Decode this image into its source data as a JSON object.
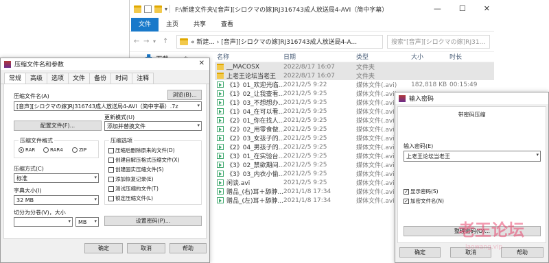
{
  "explorer": {
    "title": "F:\\新建文件夹\\[音声][シロクマの嫁]RJ316743成人放送局4-AVI（简中字幕）",
    "window_buttons": [
      "—",
      "☐",
      "✕"
    ],
    "ribbon_tabs": [
      "文件",
      "主页",
      "共享",
      "查看"
    ],
    "address": "« 新建... › [音声][シロクマの嫁]RJ316743成人放送局4-A...",
    "search_placeholder": "搜索\"[音声][シロクマの嫁]RJ31...",
    "nav_item": "下载",
    "columns": {
      "name": "名称",
      "date": "日期",
      "type": "类型",
      "size": "大小",
      "length": "时长"
    },
    "files": [
      {
        "name": "__MACOSX",
        "date": "2022/8/17 16:07",
        "type": "文件夹",
        "size": "",
        "length": "",
        "icon": "folder",
        "selected": true
      },
      {
        "name": "上老王论坛当老王",
        "date": "2022/8/17 16:07",
        "type": "文件夹",
        "size": "",
        "length": "",
        "icon": "folder",
        "selected": true
      },
      {
        "name": "《1》01_欢迎光临...",
        "date": "2021/2/5 9:22",
        "type": "媒体文件(.avi)",
        "size": "182,818 KB",
        "length": "00:15:49",
        "icon": "media"
      },
      {
        "name": "《1》02_让我查看...",
        "date": "2021/2/5 9:25",
        "type": "媒体文件(.avi)",
        "size": "",
        "length": "",
        "icon": "media"
      },
      {
        "name": "《1》03_不想想办...",
        "date": "2021/2/5 9:25",
        "type": "媒体文件(.avi)",
        "size": "",
        "length": "",
        "icon": "media"
      },
      {
        "name": "《1》04_在可以看...",
        "date": "2021/2/5 9:25",
        "type": "媒体文件(.avi)",
        "size": "",
        "length": "",
        "icon": "media"
      },
      {
        "name": "《2》01_你在找人...",
        "date": "2021/2/5 9:25",
        "type": "媒体文件(.avi)",
        "size": "",
        "length": "",
        "icon": "media"
      },
      {
        "name": "《2》02_用零食做...",
        "date": "2021/2/5 9:25",
        "type": "媒体文件(.avi)",
        "size": "",
        "length": "",
        "icon": "media"
      },
      {
        "name": "《2》03_女孩子的...",
        "date": "2021/2/5 9:25",
        "type": "媒体文件(.avi)",
        "size": "",
        "length": "",
        "icon": "media"
      },
      {
        "name": "《2》04_男孩子的...",
        "date": "2021/2/5 9:25",
        "type": "媒体文件(.avi)",
        "size": "",
        "length": "",
        "icon": "media"
      },
      {
        "name": "《3》01_在实验台...",
        "date": "2021/2/5 9:25",
        "type": "媒体文件(.avi)",
        "size": "",
        "length": "",
        "icon": "media"
      },
      {
        "name": "《3》02_禁欲期间...",
        "date": "2021/2/5 9:25",
        "type": "媒体文件(.avi)",
        "size": "",
        "length": "",
        "icon": "media"
      },
      {
        "name": "《3》03_内衣小偷...",
        "date": "2021/2/5 9:25",
        "type": "媒体文件(.avi)",
        "size": "",
        "length": "",
        "icon": "media"
      },
      {
        "name": "闲谈.avi",
        "date": "2021/2/5 9:25",
        "type": "媒体文件(.avi)",
        "size": "",
        "length": "",
        "icon": "media"
      },
      {
        "name": "赠品_(右)耳＋舔脖...",
        "date": "2021/1/8 17:34",
        "type": "媒体文件(.avi)",
        "size": "",
        "length": "",
        "icon": "media"
      },
      {
        "name": "赠品_(左)耳＋舔脖...",
        "date": "2021/1/8 17:34",
        "type": "媒体文件(.avi)",
        "size": "",
        "length": "",
        "icon": "media"
      }
    ]
  },
  "zip_dialog": {
    "title": "压缩文件名和参数",
    "tabs": [
      "常规",
      "高级",
      "选项",
      "文件",
      "备份",
      "时间",
      "注释"
    ],
    "archive_name_label": "压缩文件名(A)",
    "browse_button": "浏览(B)...",
    "archive_name_value": "[音声][シロクマの嫁]RJ316743成人放送局4-AVI（简中字幕）.7z",
    "profile_button": "配置文件(F)...",
    "update_mode_label": "更新模式(U)",
    "update_mode_value": "添加并替换文件",
    "format_group": "压缩文件格式",
    "formats": [
      "RAR",
      "RAR4",
      "ZIP"
    ],
    "selected_format": "RAR",
    "options_group": "压缩选项",
    "options": [
      {
        "label": "压缩后删除原来的文件(D)",
        "checked": false
      },
      {
        "label": "创建自解压格式压缩文件(X)",
        "checked": false
      },
      {
        "label": "创建固实压缩文件(S)",
        "checked": false
      },
      {
        "label": "添加恢复记录(E)",
        "checked": false
      },
      {
        "label": "测试压缩的文件(T)",
        "checked": false
      },
      {
        "label": "锁定压缩文件(L)",
        "checked": false
      }
    ],
    "method_label": "压缩方式(C)",
    "method_value": "标准",
    "dict_label": "字典大小(I)",
    "dict_value": "32 MB",
    "split_label": "切分为分卷(V)，大小",
    "split_value": "",
    "split_unit": "MB",
    "set_password_button": "设置密码(P)...",
    "ok": "确定",
    "cancel": "取消",
    "help": "帮助"
  },
  "pwd_dialog": {
    "title": "输入密码",
    "heading": "带密码压缩",
    "enter_label": "输入密码(E)",
    "password_value": "上老王论坛当老王",
    "show_password": "显示密码(S)",
    "show_password_checked": true,
    "encrypt_names": "加密文件名(N)",
    "encrypt_names_checked": true,
    "organize_button": "整理密码(O)...",
    "ok": "确定",
    "cancel": "取消",
    "help": "帮助"
  },
  "watermark": {
    "text": "老王论坛",
    "url": "laowang.vip"
  }
}
